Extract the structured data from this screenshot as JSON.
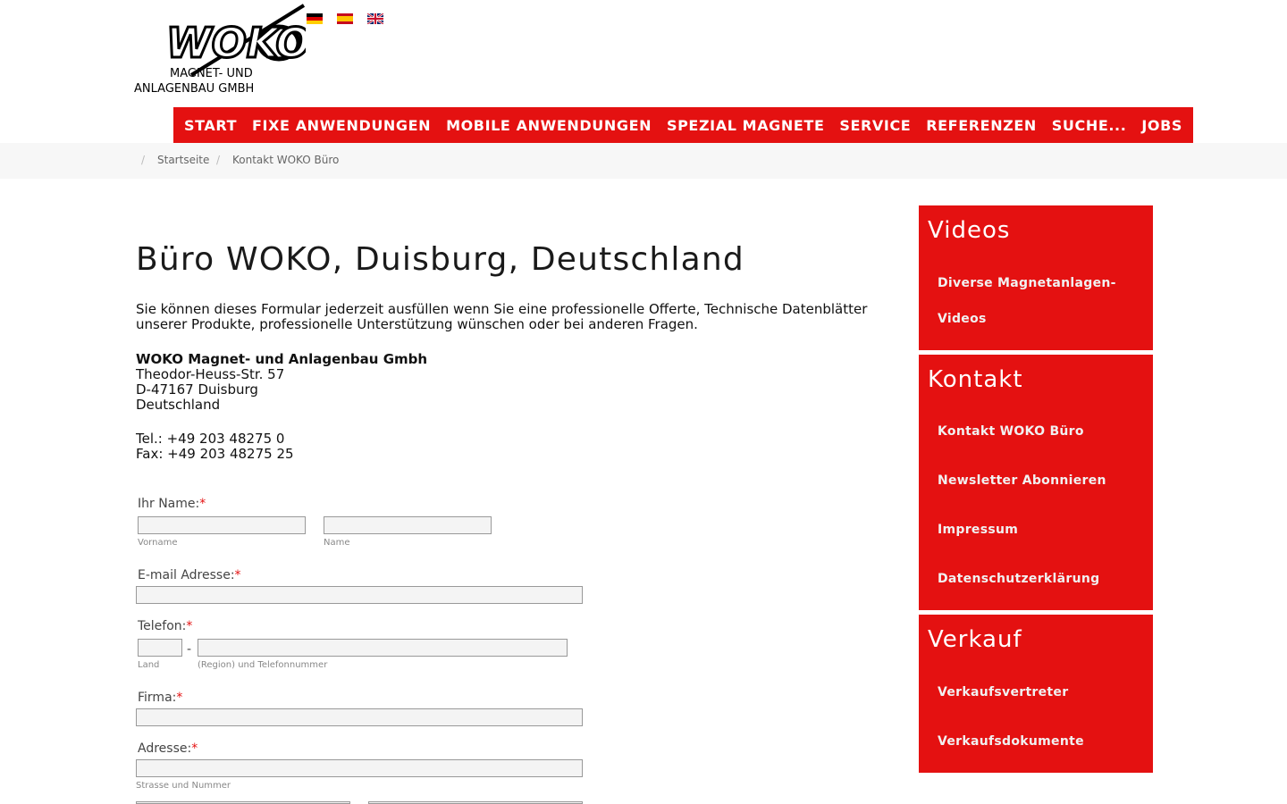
{
  "header": {
    "logo_text": "WOKO",
    "logo_sub1": "MAGNET- UND",
    "logo_sub2": "ANLAGENBAU GMBH",
    "languages": [
      "Deutsch",
      "Español",
      "English"
    ]
  },
  "nav": {
    "items": [
      "START",
      "FIXE ANWENDUNGEN",
      "MOBILE ANWENDUNGEN",
      "SPEZIAL MAGNETE",
      "SERVICE",
      "REFERENZEN",
      "SUCHE...",
      "JOBS"
    ]
  },
  "breadcrumb": {
    "home": "Startseite",
    "current": "Kontakt WOKO Büro",
    "separator": "/"
  },
  "main": {
    "title": "Büro WOKO, Duisburg, Deutschland",
    "intro": "Sie können dieses Formular jederzeit ausfüllen wenn Sie eine professionelle Offerte, Technische Datenblätter unserer Produkte, professionelle Unterstützung wünschen oder bei anderen Fragen.",
    "company": "WOKO Magnet- und Anlagenbau Gmbh",
    "street": "Theodor-Heuss-Str. 57",
    "city": "D-47167 Duisburg",
    "country": "Deutschland",
    "tel": "Tel.: +49 203 48275 0",
    "fax": "Fax: +49 203 48275 25"
  },
  "form": {
    "required_mark": "*",
    "name_label": "Ihr Name:",
    "firstname_sub": "Vorname",
    "lastname_sub": "Name",
    "email_label": "E-mail Adresse:",
    "phone_label": "Telefon:",
    "phone_dash": "-",
    "country_sub": "Land",
    "number_sub": "(Region) und Telefonnummer",
    "company_label": "Firma:",
    "address_label": "Adresse:",
    "street_sub": "Strasse und Nummer"
  },
  "sidebar": {
    "videos": {
      "title": "Videos",
      "links": [
        "Diverse Magnetanlagen-",
        "Videos"
      ]
    },
    "kontakt": {
      "title": "Kontakt",
      "links": [
        "Kontakt WOKO Büro",
        "Newsletter Abonnieren",
        "Impressum",
        "Datenschutzerklärung"
      ]
    },
    "verkauf": {
      "title": "Verkauf",
      "links": [
        "Verkaufsvertreter",
        "Verkaufsdokumente"
      ]
    }
  },
  "colors": {
    "brand_red": "#e41111"
  }
}
